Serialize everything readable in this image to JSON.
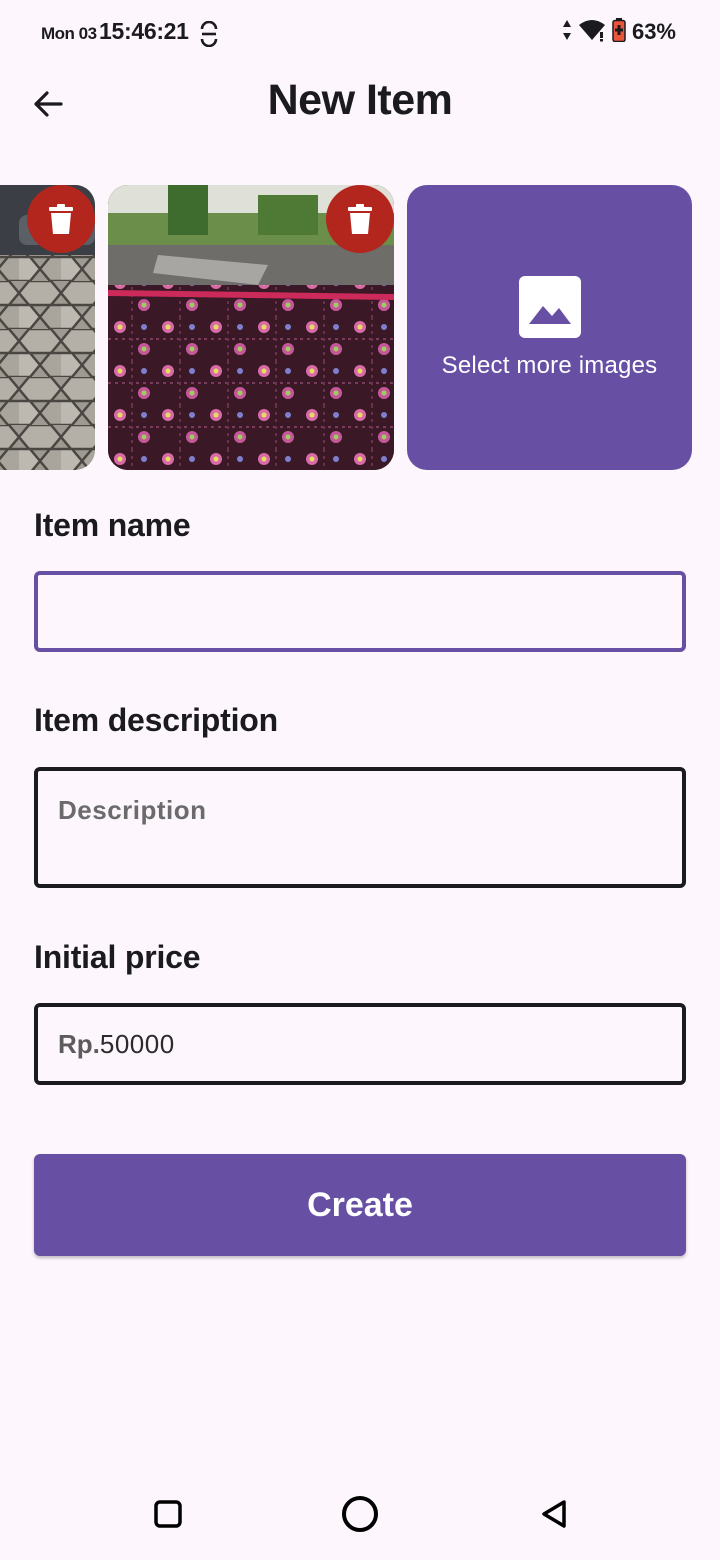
{
  "status_bar": {
    "date": "Mon 03",
    "time": "15:46:21",
    "battery_percent": "63%",
    "icons": [
      "sync-icon",
      "data-arrows-icon",
      "wifi-icon",
      "battery-icon"
    ]
  },
  "header": {
    "title": "New Item",
    "back_icon": "arrow-left-icon"
  },
  "images": {
    "thumbnails": [
      {
        "kind": "paving-stones-photo",
        "delete_icon": "trash-icon"
      },
      {
        "kind": "carpet-photo",
        "delete_icon": "trash-icon"
      }
    ],
    "add_label": "Select more images",
    "add_icon": "image-icon"
  },
  "form": {
    "name_label": "Item name",
    "name_value": "",
    "description_label": "Item description",
    "description_placeholder": "Description",
    "price_label": "Initial price",
    "price_prefix": "Rp.",
    "price_value": "50000",
    "create_label": "Create"
  },
  "colors": {
    "accent": "#6750a4",
    "delete": "#b3261e",
    "background": "#fdf7fd"
  },
  "nav_bar": [
    "recents-square-icon",
    "home-circle-icon",
    "back-triangle-icon"
  ]
}
